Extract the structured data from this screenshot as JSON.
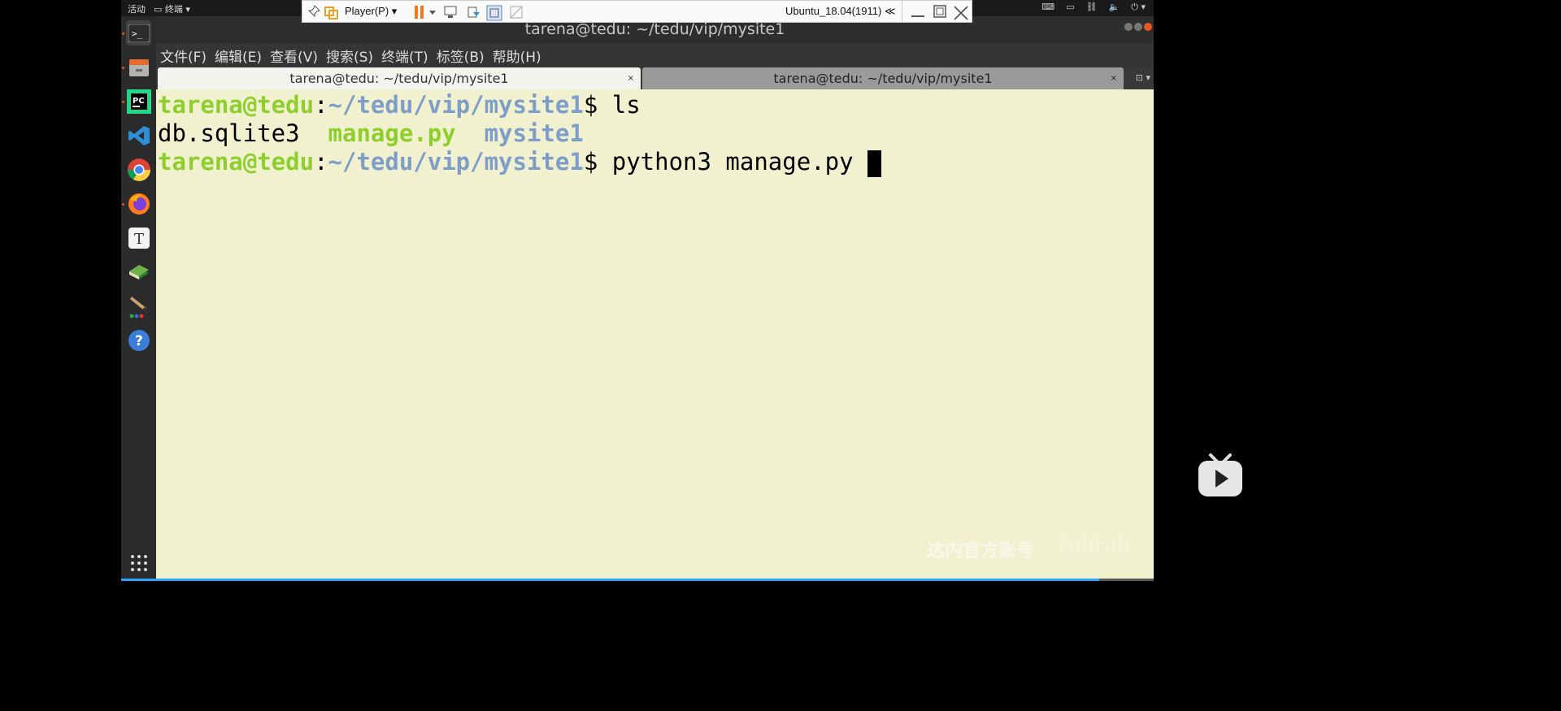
{
  "top_panel": {
    "activities": "活动",
    "app_menu": "终端",
    "tray_icons": [
      "keyboard-icon",
      "display-icon",
      "network-icon",
      "volume-icon",
      "power-icon"
    ]
  },
  "dock": {
    "items": [
      "terminal-icon",
      "files-icon",
      "pycharm-icon",
      "vscode-icon",
      "chrome-icon",
      "firefox-icon",
      "typora-icon",
      "books-icon",
      "paint-icon",
      "help-icon"
    ],
    "apps_icon": "show-apps-icon",
    "pycharm_label": "PC",
    "typora_label": "T",
    "help_label": "?"
  },
  "window": {
    "title": "tarena@tedu: ~/tedu/vip/mysite1",
    "menu": [
      "文件(F)",
      "编辑(E)",
      "查看(V)",
      "搜索(S)",
      "终端(T)",
      "标签(B)",
      "帮助(H)"
    ],
    "tabs": [
      {
        "label": "tarena@tedu: ~/tedu/vip/mysite1",
        "close": "×"
      },
      {
        "label": "tarena@tedu: ~/tedu/vip/mysite1",
        "close": "×"
      }
    ]
  },
  "terminal": {
    "line1": {
      "user_host": "tarena@tedu",
      "sep": ":",
      "path": "~/tedu/vip/mysite1",
      "prompt": "$ ",
      "cmd": "ls"
    },
    "line2": {
      "file1": "db.sqlite3",
      "file2": "manage.py",
      "file3": "mysite1"
    },
    "line3": {
      "user_host": "tarena@tedu",
      "sep": ":",
      "path": "~/tedu/vip/mysite1",
      "prompt": "$ ",
      "cmd": "python3 manage.py "
    }
  },
  "vm_toolbar": {
    "player_label": "Player(P)",
    "vm_name": "Ubuntu_18.04(1911)",
    "collapse": "≪"
  },
  "video": {
    "progress": 0.947,
    "watermark": "达内官方账号",
    "watermark_logo": "bilibili"
  },
  "colors": {
    "terminal_bg": "#f1f1d0",
    "prompt_green": "#8ecf2e",
    "path_blue": "#7d9ec8",
    "progress_blue": "#27a6ff"
  }
}
